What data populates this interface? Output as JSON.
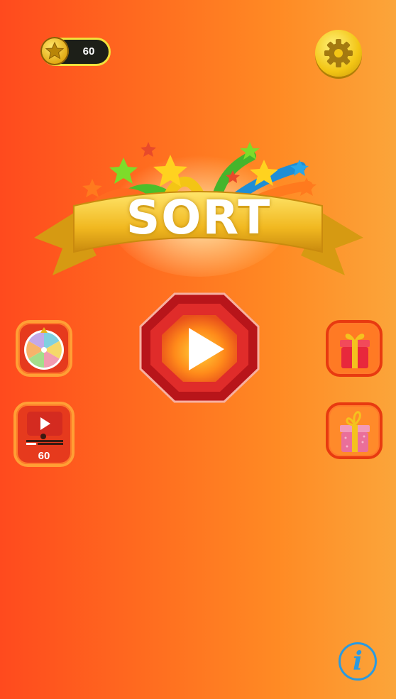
{
  "coins": {
    "value": "60",
    "icon": "star-coin-icon"
  },
  "settings": {
    "icon": "gear-icon"
  },
  "title": {
    "text": "SORT"
  },
  "play": {
    "icon": "play-icon"
  },
  "left_buttons": [
    {
      "name": "spin-wheel",
      "icon": "wheel-icon"
    },
    {
      "name": "video-reward",
      "icon": "video-icon",
      "label": "60"
    }
  ],
  "right_buttons": [
    {
      "name": "daily-gift",
      "icon": "gift-icon"
    },
    {
      "name": "bonus-gift",
      "icon": "gift-icon"
    }
  ],
  "info": {
    "icon": "info-icon",
    "glyph": "i"
  },
  "colors": {
    "accent_red": "#e63a1d",
    "gold": "#f3c515",
    "info_blue": "#2a9ae0"
  }
}
